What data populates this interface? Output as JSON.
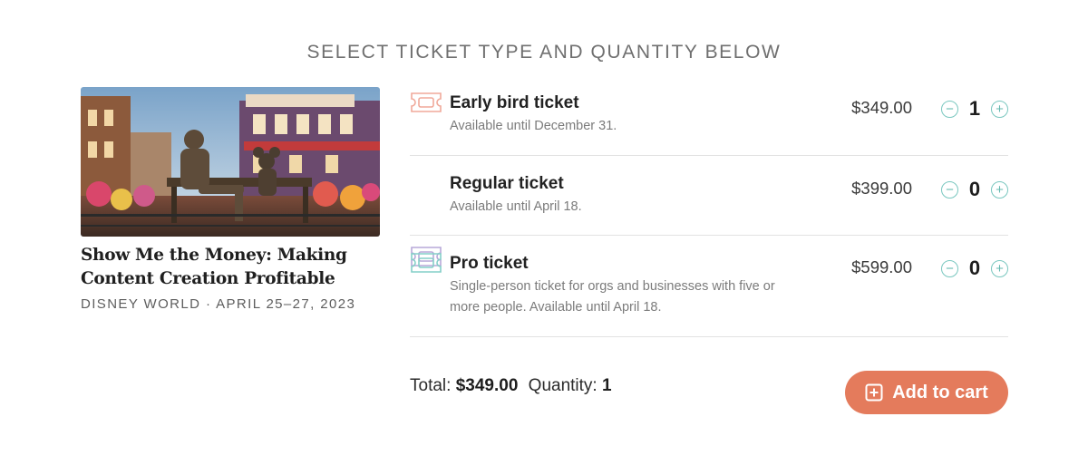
{
  "heading": "SELECT TICKET TYPE AND QUANTITY BELOW",
  "event": {
    "image_alt": "Statue on a bench in a themed town square",
    "title_line1": "Show Me the Money: Making",
    "title_line2": "Content Creation Profitable",
    "meta": "DISNEY WORLD · APRIL 25–27, 2023"
  },
  "tickets": [
    {
      "name": "Early bird ticket",
      "desc_line1": "Available until December 31.",
      "desc_line2": "",
      "price": "$349.00",
      "quantity": "1",
      "icon": "ticket-icon",
      "color": "#f0a99a"
    },
    {
      "name": "Regular ticket",
      "desc_line1": "Available until April 18.",
      "desc_line2": "",
      "price": "$399.00",
      "quantity": "0",
      "icon": "ticket-icon",
      "color": "#b7a9d8"
    },
    {
      "name": "Pro ticket",
      "desc_line1": "Single-person ticket for orgs and businesses with five or",
      "desc_line2": "more people. Available until April 18.",
      "price": "$599.00",
      "quantity": "0",
      "icon": "ticket-icon",
      "color": "#84cfc8"
    }
  ],
  "controls": {
    "minus_symbol": "−",
    "plus_symbol": "+",
    "stepper_color": "#79c7bf"
  },
  "summary": {
    "total_label": "Total:",
    "total_value": "$349.00",
    "quantity_label": "Quantity:",
    "quantity_value": "1"
  },
  "cart_button": {
    "label": "Add to cart",
    "icon": "plus-square-icon",
    "color": "#e47b5c"
  }
}
